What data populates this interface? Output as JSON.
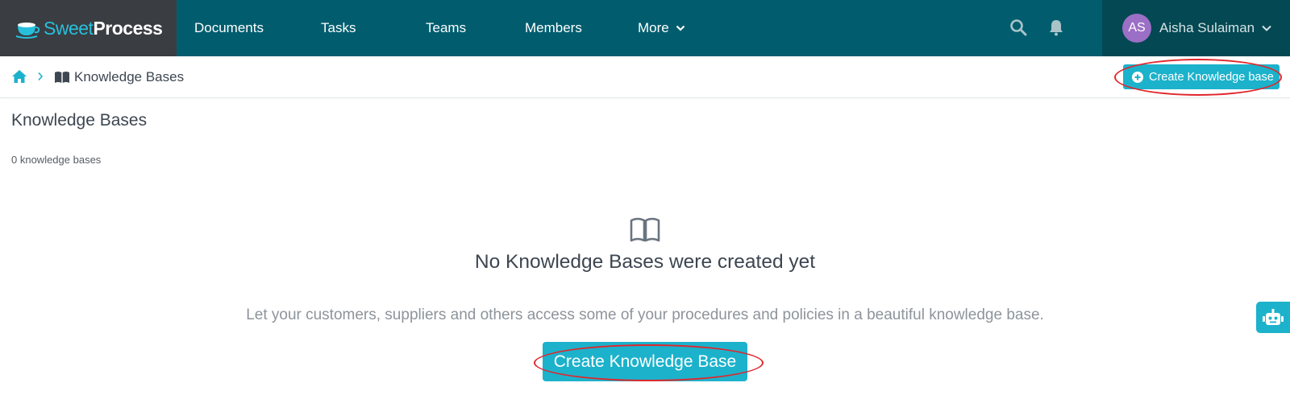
{
  "app": {
    "logo_light": "Sweet",
    "logo_bold": "Process"
  },
  "nav": {
    "items": [
      {
        "label": "Documents"
      },
      {
        "label": "Tasks"
      },
      {
        "label": "Teams"
      },
      {
        "label": "Members"
      },
      {
        "label": "More"
      }
    ],
    "icons": [
      "search-icon",
      "bell-icon"
    ]
  },
  "user": {
    "initials": "AS",
    "name": "Aisha Sulaiman",
    "avatar_color": "#9b6fc6"
  },
  "breadcrumb": {
    "current": "Knowledge Bases"
  },
  "toolbar": {
    "create_label": "Create Knowledge base"
  },
  "page": {
    "title": "Knowledge Bases",
    "count": "0 knowledge bases"
  },
  "empty_state": {
    "title": "No Knowledge Bases were created yet",
    "description": "Let your customers, suppliers and others access some of your procedures and policies in a beautiful knowledge base.",
    "button_label": "Create Knowledge Base"
  },
  "colors": {
    "topbar": "#015d6e",
    "accent": "#1cb2cb",
    "annotation": "#e0262c"
  }
}
